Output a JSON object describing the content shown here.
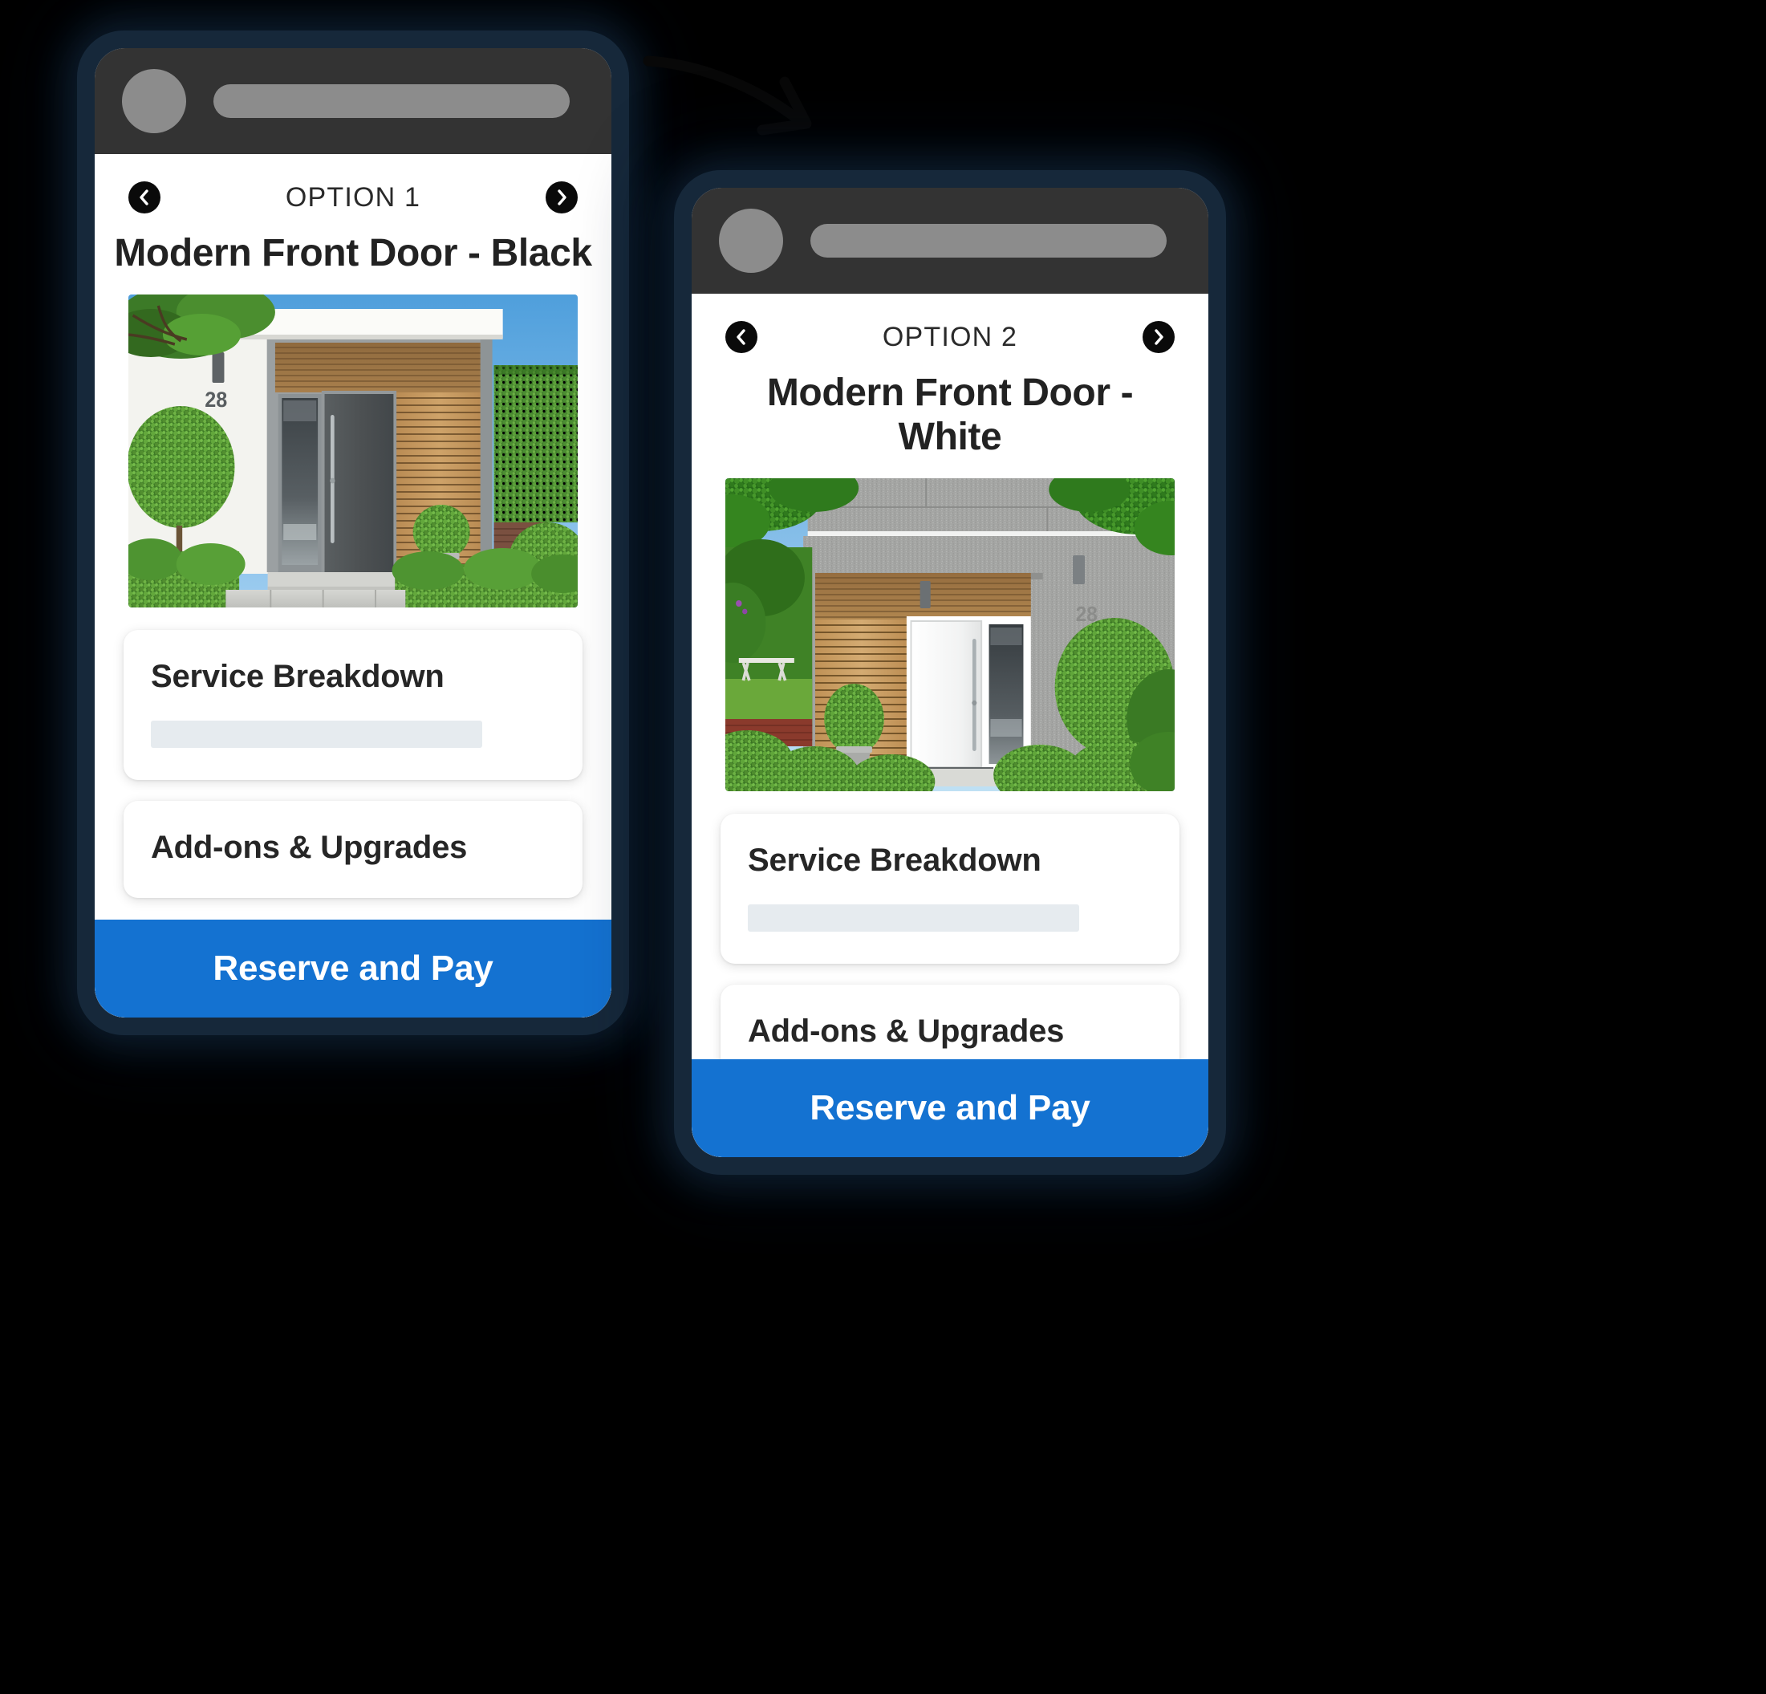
{
  "background_color": "#000000",
  "accent_color": "#1472d1",
  "phone_frame_color": "#16283a",
  "topbar_color": "#333333",
  "annotation": {
    "arrow": "curved-arrow-pointing-right-down",
    "color": "#0a0a0a"
  },
  "phones": [
    {
      "id": "phone-option-1",
      "topbar": {
        "avatar": "avatar-placeholder",
        "address_pill": "address-bar-placeholder"
      },
      "nav": {
        "prev_icon": "chevron-left-icon",
        "next_icon": "chevron-right-icon",
        "option_label": "OPTION 1"
      },
      "title": "Modern Front Door - Black",
      "hero": {
        "name": "front-door-black-photo",
        "house_number": "28",
        "door_color": "#4a4e50",
        "wall_color": "#f2f2ee",
        "wood_color": "#c49a62",
        "sky_color": "#5fa8e0",
        "alt": "Modern house entrance with dark grey front door, wood slat cladding, white render wall and trimmed box hedges"
      },
      "cards": [
        {
          "title": "Service Breakdown",
          "skeleton": "loading-line"
        },
        {
          "title": "Add-ons & Upgrades",
          "skeleton": null
        }
      ],
      "cta": "Reserve and Pay"
    },
    {
      "id": "phone-option-2",
      "topbar": {
        "avatar": "avatar-placeholder",
        "address_pill": "address-bar-placeholder"
      },
      "nav": {
        "prev_icon": "chevron-left-icon",
        "next_icon": "chevron-right-icon",
        "option_label": "OPTION 2"
      },
      "title": "Modern Front Door - White",
      "hero": {
        "name": "front-door-white-photo",
        "house_number": "28",
        "door_color": "#f7f8f8",
        "wall_color": "#a6a6a4",
        "wood_color": "#c9a470",
        "sky_color": "#7fb9e6",
        "alt": "Modern house entrance with white front door, wood slat cladding, grey concrete wall and round topiary bushes"
      },
      "cards": [
        {
          "title": "Service Breakdown",
          "skeleton": "loading-line"
        },
        {
          "title": "Add-ons & Upgrades",
          "skeleton": null
        }
      ],
      "cta": "Reserve and Pay"
    }
  ]
}
